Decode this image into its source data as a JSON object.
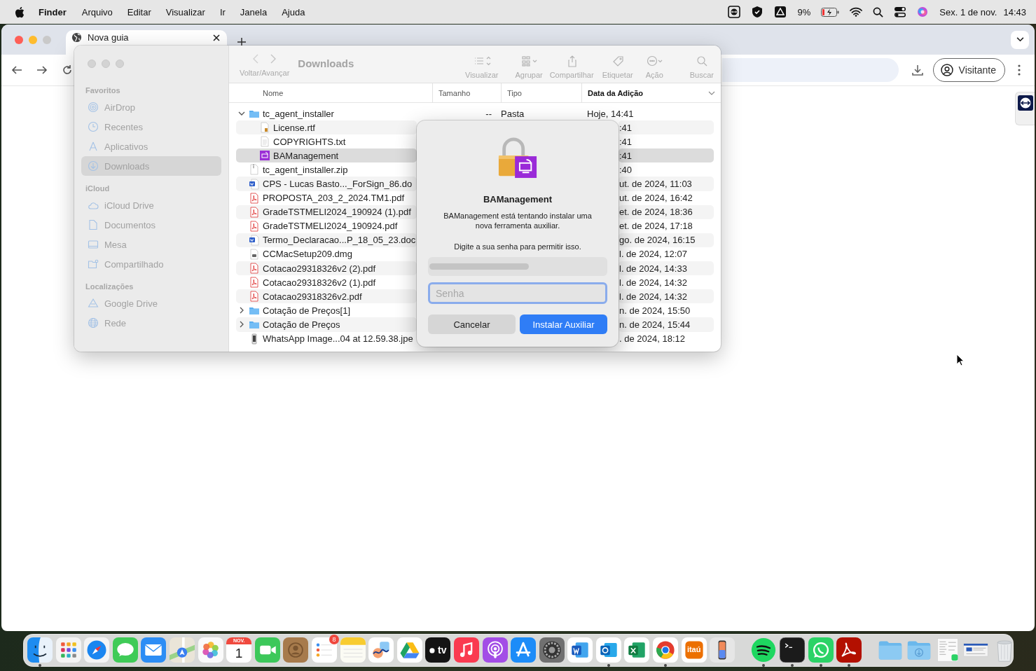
{
  "menu_bar": {
    "app": "Finder",
    "menus": [
      "Arquivo",
      "Editar",
      "Visualizar",
      "Ir",
      "Janela",
      "Ajuda"
    ],
    "battery": "9%",
    "date": "Sex. 1 de nov.",
    "time": "14:43"
  },
  "browser": {
    "tabs": [
      {
        "title": "Nova guia",
        "selected": true
      }
    ],
    "profile": "Visitante"
  },
  "finder": {
    "title": "Downloads",
    "nav_label": "Voltar/Avançar",
    "toolbar": [
      {
        "kind": "view",
        "label": "Visualizar"
      },
      {
        "kind": "group",
        "label": "Agrupar"
      },
      {
        "kind": "share",
        "label": "Compartilhar"
      },
      {
        "kind": "tag",
        "label": "Etiquetar"
      },
      {
        "kind": "action",
        "label": "Ação"
      },
      {
        "kind": "search",
        "label": "Buscar"
      }
    ],
    "sidebar": [
      {
        "title": "Favoritos",
        "items": [
          {
            "kind": "airdrop",
            "label": "AirDrop",
            "selected": false
          },
          {
            "kind": "clock",
            "label": "Recentes",
            "selected": false
          },
          {
            "kind": "apps",
            "label": "Aplicativos",
            "selected": false
          },
          {
            "kind": "download",
            "label": "Downloads",
            "selected": true
          }
        ]
      },
      {
        "title": "iCloud",
        "items": [
          {
            "kind": "cloud",
            "label": "iCloud Drive",
            "selected": false
          },
          {
            "kind": "doc",
            "label": "Documentos",
            "selected": false
          },
          {
            "kind": "desktop",
            "label": "Mesa",
            "selected": false
          },
          {
            "kind": "shared",
            "label": "Compartilhado",
            "selected": false
          }
        ]
      },
      {
        "title": "Localizações",
        "items": [
          {
            "kind": "drive",
            "label": "Google Drive",
            "selected": false
          },
          {
            "kind": "globe",
            "label": "Rede",
            "selected": false
          }
        ]
      }
    ],
    "columns": [
      {
        "label": "Nome",
        "sorted": false
      },
      {
        "label": "Tamanho",
        "sorted": false
      },
      {
        "label": "Tipo",
        "sorted": false
      },
      {
        "label": "Data da Adição",
        "sorted": true
      }
    ],
    "files": [
      {
        "kind": "folder",
        "name": "tc_agent_installer",
        "size": "--",
        "type": "Pasta",
        "date": "Hoje, 14:41",
        "selected": false,
        "expanded": true,
        "children": [
          {
            "kind": "rtf",
            "name": "License.rtf",
            "date": ":41",
            "selected": false
          },
          {
            "kind": "txt",
            "name": "COPYRIGHTS.txt",
            "date": ":41",
            "selected": false
          },
          {
            "kind": "app",
            "name": "BAManagement",
            "date": ":41",
            "selected": true
          }
        ]
      },
      {
        "kind": "zip",
        "name": "tc_agent_installer.zip",
        "date": ":40",
        "selected": false
      },
      {
        "kind": "word",
        "name": "CPS - Lucas Basto..._ForSign_86.do",
        "date": "ut. de 2024, 11:03",
        "selected": false
      },
      {
        "kind": "pdf",
        "name": "PROPOSTA_203_2_2024.TM1.pdf",
        "date": "ut. de 2024, 16:42",
        "selected": false
      },
      {
        "kind": "pdf",
        "name": "GradeTSTMELI2024_190924 (1).pdf",
        "date": "et. de 2024, 18:36",
        "selected": false
      },
      {
        "kind": "pdf",
        "name": "GradeTSTMELI2024_190924.pdf",
        "date": "et. de 2024, 17:18",
        "selected": false
      },
      {
        "kind": "word",
        "name": "Termo_Declaracao...P_18_05_23.doc",
        "date": "go. de 2024, 16:15",
        "selected": false
      },
      {
        "kind": "dmg",
        "name": "CCMacSetup209.dmg",
        "date": "l. de 2024, 12:07",
        "selected": false
      },
      {
        "kind": "pdf",
        "name": "Cotacao29318326v2 (2).pdf",
        "date": "l. de 2024, 14:33",
        "selected": false
      },
      {
        "kind": "pdf",
        "name": "Cotacao29318326v2 (1).pdf",
        "date": "l. de 2024, 14:32",
        "selected": false
      },
      {
        "kind": "pdf",
        "name": "Cotacao29318326v2.pdf",
        "date": "l. de 2024, 14:32",
        "selected": false
      },
      {
        "kind": "folder",
        "name": "Cotação de Preços[1]",
        "date": "n. de 2024, 15:50",
        "selected": false,
        "expanded": false
      },
      {
        "kind": "folder",
        "name": "Cotação de Preços",
        "date": "n. de 2024, 15:44",
        "selected": false,
        "expanded": false
      },
      {
        "kind": "image",
        "name": "WhatsApp Image...04 at 12.59.38.jpe",
        "date": ". de 2024, 18:12",
        "selected": false
      }
    ]
  },
  "dialog": {
    "title": "BAManagement",
    "message": "BAManagement está tentando instalar uma nova ferramenta auxiliar.",
    "prompt": "Digite a sua senha para permitir isso.",
    "password": {
      "placeholder": "Senha",
      "focused": true
    },
    "buttons": [
      {
        "label": "Cancelar",
        "default": false
      },
      {
        "label": "Instalar Auxiliar",
        "default": true
      }
    ]
  },
  "dock": {
    "items": [
      {
        "kind": "finder",
        "running": true
      },
      {
        "kind": "launchpad",
        "running": false
      },
      {
        "kind": "safari",
        "running": false
      },
      {
        "kind": "messages",
        "running": false
      },
      {
        "kind": "mail",
        "running": false
      },
      {
        "kind": "maps",
        "running": false
      },
      {
        "kind": "photos",
        "running": false
      },
      {
        "kind": "calendar",
        "running": false,
        "month": "NOV.",
        "day": "1"
      },
      {
        "kind": "facetime",
        "running": false
      },
      {
        "kind": "contacts",
        "running": false
      },
      {
        "kind": "reminders",
        "running": false,
        "badge": "8"
      },
      {
        "kind": "notes",
        "running": false
      },
      {
        "kind": "freeform",
        "running": false
      },
      {
        "kind": "drive",
        "running": false
      },
      {
        "kind": "tv",
        "running": false,
        "text": "tv"
      },
      {
        "kind": "music",
        "running": false
      },
      {
        "kind": "podcasts",
        "running": false
      },
      {
        "kind": "appstore",
        "running": false
      },
      {
        "kind": "settings",
        "running": false
      },
      {
        "kind": "word",
        "running": false
      },
      {
        "kind": "outlook",
        "running": true
      },
      {
        "kind": "excel",
        "running": false
      },
      {
        "kind": "chrome",
        "running": true
      },
      {
        "kind": "bank",
        "running": false,
        "text": "itaú"
      },
      {
        "kind": "phone",
        "running": false
      },
      {
        "kind": "separator"
      },
      {
        "kind": "spotify",
        "running": true
      },
      {
        "kind": "terminal",
        "running": true
      },
      {
        "kind": "whatsapp",
        "running": true
      },
      {
        "kind": "acrobat",
        "running": true
      },
      {
        "kind": "separator"
      },
      {
        "kind": "folder",
        "running": false
      },
      {
        "kind": "downloads",
        "running": false
      },
      {
        "kind": "window",
        "running": false
      },
      {
        "kind": "window2",
        "running": false
      },
      {
        "kind": "trash",
        "running": false
      }
    ]
  }
}
